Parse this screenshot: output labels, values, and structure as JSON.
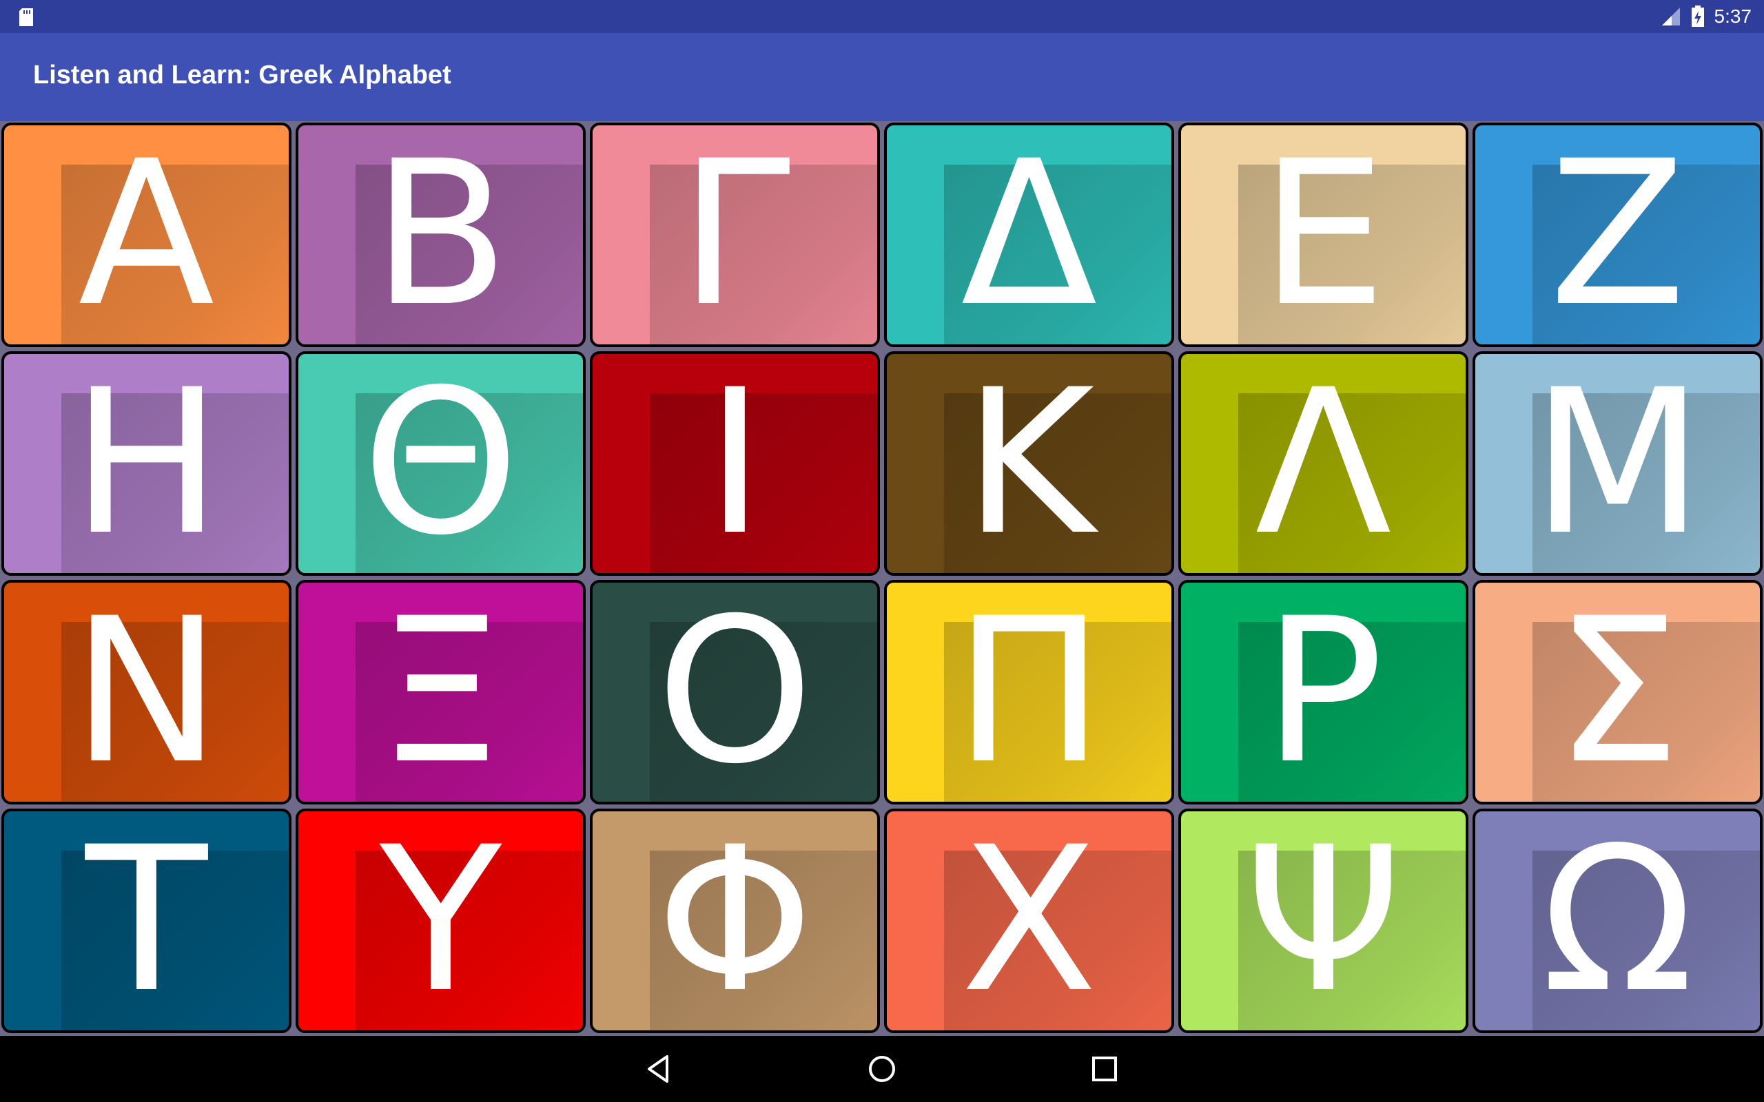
{
  "status_bar": {
    "time": "5:37",
    "icons": [
      "sd-card-icon",
      "signal-icon",
      "battery-icon"
    ]
  },
  "app_bar": {
    "title": "Listen and Learn: Greek Alphabet"
  },
  "tiles": [
    {
      "letter": "Α",
      "color": "#ff8f42"
    },
    {
      "letter": "Β",
      "color": "#a866ab"
    },
    {
      "letter": "Γ",
      "color": "#f08a98"
    },
    {
      "letter": "Δ",
      "color": "#2ebfb8"
    },
    {
      "letter": "Ε",
      "color": "#f0d3a0"
    },
    {
      "letter": "Ζ",
      "color": "#3498db"
    },
    {
      "letter": "Η",
      "color": "#ae7fc8"
    },
    {
      "letter": "Θ",
      "color": "#48cbb0"
    },
    {
      "letter": "Ι",
      "color": "#b8000d"
    },
    {
      "letter": "Κ",
      "color": "#6b4a15"
    },
    {
      "letter": "Λ",
      "color": "#aeba00"
    },
    {
      "letter": "Μ",
      "color": "#93c0d8"
    },
    {
      "letter": "Ν",
      "color": "#d94f0a"
    },
    {
      "letter": "Ξ",
      "color": "#c0109a"
    },
    {
      "letter": "Ο",
      "color": "#2a4d45"
    },
    {
      "letter": "Π",
      "color": "#fdd51d"
    },
    {
      "letter": "Ρ",
      "color": "#00b064"
    },
    {
      "letter": "Σ",
      "color": "#f8ac84"
    },
    {
      "letter": "Τ",
      "color": "#005a80"
    },
    {
      "letter": "Υ",
      "color": "#ff0000"
    },
    {
      "letter": "Φ",
      "color": "#c59a6b"
    },
    {
      "letter": "Χ",
      "color": "#f8694b"
    },
    {
      "letter": "Ψ",
      "color": "#b0e860"
    },
    {
      "letter": "Ω",
      "color": "#7e7fb8"
    }
  ],
  "nav_bar": {
    "buttons": [
      "back-icon",
      "home-icon",
      "recents-icon"
    ]
  }
}
